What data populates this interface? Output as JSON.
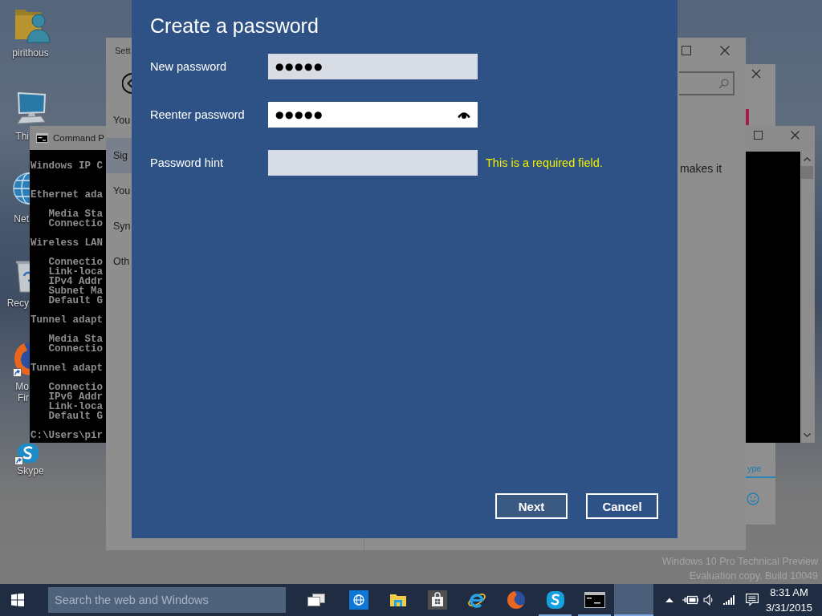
{
  "desktop": {
    "icons": [
      {
        "kind": "user-folder",
        "lines": [
          "pirithous"
        ],
        "shortcut": false
      },
      {
        "kind": "computer",
        "lines": [
          "Thi"
        ],
        "shortcut": false
      },
      {
        "kind": "network",
        "lines": [
          "Net"
        ],
        "shortcut": false
      },
      {
        "kind": "recycle-bin",
        "lines": [
          "Recy"
        ],
        "shortcut": false
      },
      {
        "kind": "browser",
        "lines": [
          "Mo",
          "Fir"
        ],
        "shortcut": true
      },
      {
        "kind": "messenger",
        "lines": [
          "Skype"
        ],
        "shortcut": true
      }
    ],
    "watermark": [
      "Windows 10 Pro Technical Preview",
      "Evaluation copy. Build 10049"
    ]
  },
  "chat_window": {
    "tab": {
      "label": "ype",
      "selected": true
    }
  },
  "command_prompt": {
    "title": "Command P",
    "sections": [
      {
        "heading": "Windows IP C"
      },
      {
        "heading": "Ethernet ada",
        "items": [
          "Media Sta",
          "Connectio"
        ]
      },
      {
        "heading": "Wireless LAN",
        "items": [
          "Connectio",
          "Link-loca",
          "IPv4 Addr",
          "Subnet Ma",
          "Default G"
        ]
      },
      {
        "heading": "Tunnel adapt",
        "items": [
          "Media Sta",
          "Connectio"
        ]
      },
      {
        "heading": "Tunnel adapt",
        "items": [
          "Connectio",
          "IPv6 Addr",
          "Link-loca",
          "Default G"
        ]
      },
      {
        "heading": "C:\\Users\\pir"
      }
    ]
  },
  "settings": {
    "title": "Sett",
    "nav": [
      {
        "label": "You",
        "selected": false
      },
      {
        "label": "Sig",
        "selected": true
      },
      {
        "label": "You",
        "selected": false
      },
      {
        "label": "Syn",
        "selected": false
      },
      {
        "label": "Oth",
        "selected": false
      }
    ],
    "text": "makes it"
  },
  "dialog": {
    "title": "Create a password",
    "fields": [
      {
        "label": "New password",
        "kind": "password",
        "value": "●●●●●",
        "focused": false
      },
      {
        "label": "Reenter password",
        "kind": "password",
        "value": "●●●●●",
        "focused": true
      },
      {
        "label": "Password hint",
        "kind": "text",
        "focused": false,
        "error": "This is a required field."
      }
    ],
    "buttons": [
      {
        "label": "Next",
        "default": true
      },
      {
        "label": "Cancel",
        "default": false
      }
    ]
  },
  "taskbar": {
    "search": {
      "placeholder": "Search the web and Windows"
    },
    "apps": [
      {
        "kind": "task-view",
        "running": false,
        "active": false
      },
      {
        "kind": "web",
        "running": false,
        "active": false
      },
      {
        "kind": "explorer",
        "running": false,
        "active": false
      },
      {
        "kind": "store",
        "running": false,
        "active": false
      },
      {
        "kind": "ie",
        "running": false,
        "active": false
      },
      {
        "kind": "browser",
        "running": false,
        "active": false
      },
      {
        "kind": "messenger",
        "running": true,
        "active": false
      },
      {
        "kind": "console",
        "running": true,
        "active": false
      },
      {
        "kind": "blank",
        "running": true,
        "active": true
      }
    ],
    "time": "8:31 AM",
    "date": "3/31/2015"
  }
}
